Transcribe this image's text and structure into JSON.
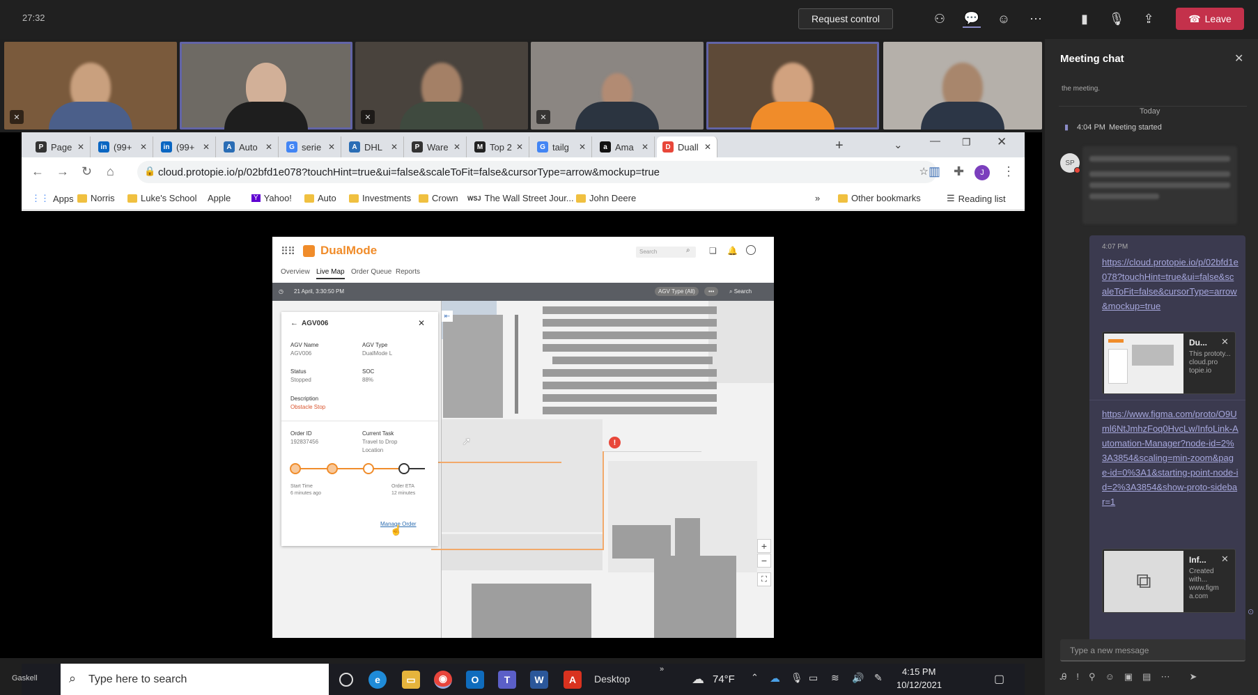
{
  "teams": {
    "meeting_time": "27:32",
    "request_control": "Request control",
    "leave": "Leave"
  },
  "browser": {
    "tabs": [
      {
        "label": "Page",
        "fav": "P",
        "color": "#333333"
      },
      {
        "label": "(99+",
        "fav": "in",
        "color": "#0a66c2"
      },
      {
        "label": "(99+",
        "fav": "in",
        "color": "#0a66c2"
      },
      {
        "label": "Auto",
        "fav": "A",
        "color": "#2a6db5"
      },
      {
        "label": "serie",
        "fav": "G",
        "color": "#4285f4"
      },
      {
        "label": "DHL",
        "fav": "A",
        "color": "#2a6db5"
      },
      {
        "label": "Ware",
        "fav": "P",
        "color": "#333333"
      },
      {
        "label": "Top 2",
        "fav": "M",
        "color": "#222222"
      },
      {
        "label": "tailg",
        "fav": "G",
        "color": "#4285f4"
      },
      {
        "label": "Ama",
        "fav": "a",
        "color": "#111111"
      },
      {
        "label": "Duall",
        "fav": "D",
        "color": "#e8473a"
      }
    ],
    "url": "cloud.protopie.io/p/02bfd1e078?touchHint=true&ui=false&scaleToFit=false&cursorType=arrow&mockup=true",
    "profile_initial": "J",
    "bookmarks": [
      "Apps",
      "Norris",
      "Luke's School",
      "Apple",
      "Yahoo!",
      "Auto",
      "Investments",
      "Crown",
      "The Wall Street Jour...",
      "John Deere"
    ],
    "bookmarks_more": "»",
    "other_bookmarks": "Other bookmarks",
    "reading_list": "Reading list"
  },
  "proto": {
    "brand": "DualMode",
    "search_placeholder": "Search",
    "tabs": [
      "Overview",
      "Live Map",
      "Order Queue",
      "Reports"
    ],
    "active_tab": "Live Map",
    "timestamp": "21 April, 3:30:50 PM",
    "agv_filter": "AGV Type (All)",
    "search_label": "Search",
    "panel": {
      "title": "AGV006",
      "agv_name_label": "AGV Name",
      "agv_name": "AGV006",
      "agv_type_label": "AGV Type",
      "agv_type": "DualMode L",
      "status_label": "Status",
      "status": "Stopped",
      "soc_label": "SOC",
      "soc": "88%",
      "desc_label": "Description",
      "desc": "Obstacle Stop",
      "order_id_label": "Order ID",
      "order_id": "192837456",
      "task_label": "Current Task",
      "task_line1": "Travel to Drop",
      "task_line2": "Location",
      "start_label": "Start Time",
      "start_val": "6 minutes ago",
      "eta_label": "Order ETA",
      "eta_val": "12 minutes",
      "manage": "Manage Order"
    }
  },
  "chat": {
    "title": "Meeting chat",
    "prev_msg": "the meeting.",
    "today": "Today",
    "started_time": "4:04 PM",
    "started_text": "Meeting started",
    "avatar": "SP",
    "msg_time": "4:07 PM",
    "link1": "https://cloud.protopie.io/p/02bfd1e078?touchHint=true&ui=false&scaleToFit=false&cursorType=arrow&mockup=true",
    "att1_title": "Du...",
    "att1_desc": "This prototy... cloud.pro topie.io",
    "link2": "https://www.figma.com/proto/O9Uml6NtJmhzFoq0HvcLw/InfoLink-Automation-Manager?node-id=2%3A3854&scaling=min-zoom&page-id=0%3A1&starting-point-node-id=2%3A3854&show-proto-sidebar=1",
    "att2_title": "Inf...",
    "att2_desc": "Created with... www.figm a.com",
    "compose_placeholder": "Type a new message"
  },
  "taskbar": {
    "user_tag": "Gaskell",
    "search": "Type here to search",
    "desktop": "Desktop",
    "weather": "74°F",
    "time": "4:15 PM",
    "date": "10/12/2021"
  }
}
